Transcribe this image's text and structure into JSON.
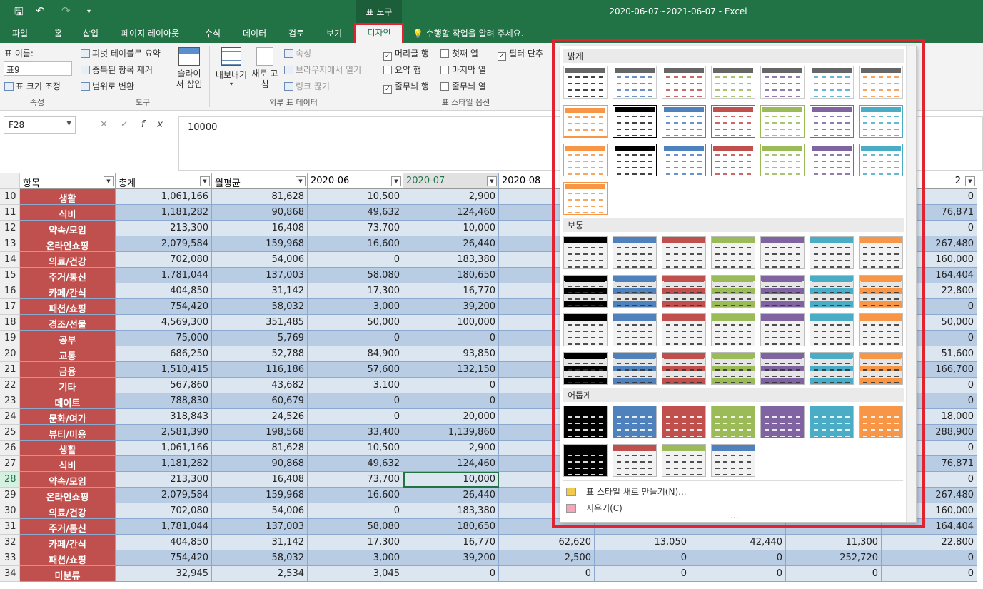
{
  "title_bar": {
    "doc_title": "2020-06-07~2021-06-07 - Excel",
    "context_label": "표 도구",
    "save": "🖫",
    "undo": "↶",
    "redo": "↷",
    "customize": "▾"
  },
  "tabs": [
    "파일",
    "홈",
    "삽입",
    "페이지 레이아웃",
    "수식",
    "데이터",
    "검토",
    "보기"
  ],
  "active_tab": "디자인",
  "tell_me": "수행할 작업을 알려 주세요.",
  "ribbon": {
    "props": {
      "table_name_label": "표 이름:",
      "table_name_value": "표9",
      "resize": "표 크기 조정",
      "group": "속성"
    },
    "tools": {
      "pivot": "피벗 테이블로 요약",
      "dedupe": "중복된 항목 제거",
      "convert": "범위로 변환",
      "slicer": "슬라이서 삽입",
      "group": "도구"
    },
    "external": {
      "export": "내보내기",
      "refresh": "새로 고침",
      "properties": "속성",
      "open_browser": "브라우저에서 열기",
      "unlink": "링크 끊기",
      "group": "외부 표 데이터"
    },
    "options": {
      "header_row": "머리글 행",
      "total_row": "요약 행",
      "banded_rows": "줄무늬 행",
      "first_col": "첫째 열",
      "last_col": "마지막 열",
      "banded_cols": "줄무늬 열",
      "filter": "필터 단추",
      "group": "표 스타일 옵션"
    }
  },
  "formula": {
    "cell_ref": "F28",
    "value": "10000"
  },
  "headers": [
    "항목",
    "총계",
    "월평균",
    "2020-06",
    "2020-07",
    "2020-08"
  ],
  "right_header_tail": "2",
  "rows": [
    {
      "n": "10",
      "cat": "생활",
      "total": "1,061,166",
      "avg": "81,628",
      "c1": "10,500",
      "c2": "2,900",
      "c3": "",
      "r": "0"
    },
    {
      "n": "11",
      "cat": "식비",
      "total": "1,181,282",
      "avg": "90,868",
      "c1": "49,632",
      "c2": "124,460",
      "c3": "",
      "r": "76,871"
    },
    {
      "n": "12",
      "cat": "약속/모임",
      "total": "213,300",
      "avg": "16,408",
      "c1": "73,700",
      "c2": "10,000",
      "c3": "",
      "r": "0"
    },
    {
      "n": "13",
      "cat": "온라인쇼핑",
      "total": "2,079,584",
      "avg": "159,968",
      "c1": "16,600",
      "c2": "26,440",
      "c3": "",
      "r": "267,480"
    },
    {
      "n": "14",
      "cat": "의료/건강",
      "total": "702,080",
      "avg": "54,006",
      "c1": "0",
      "c2": "183,380",
      "c3": "",
      "r": "160,000"
    },
    {
      "n": "15",
      "cat": "주거/통신",
      "total": "1,781,044",
      "avg": "137,003",
      "c1": "58,080",
      "c2": "180,650",
      "c3": "",
      "r": "164,404"
    },
    {
      "n": "16",
      "cat": "카페/간식",
      "total": "404,850",
      "avg": "31,142",
      "c1": "17,300",
      "c2": "16,770",
      "c3": "",
      "r": "22,800"
    },
    {
      "n": "17",
      "cat": "패션/쇼핑",
      "total": "754,420",
      "avg": "58,032",
      "c1": "3,000",
      "c2": "39,200",
      "c3": "",
      "r": "0"
    },
    {
      "n": "18",
      "cat": "경조/선물",
      "total": "4,569,300",
      "avg": "351,485",
      "c1": "50,000",
      "c2": "100,000",
      "c3": "",
      "r": "50,000"
    },
    {
      "n": "19",
      "cat": "공부",
      "total": "75,000",
      "avg": "5,769",
      "c1": "0",
      "c2": "0",
      "c3": "",
      "r": "0"
    },
    {
      "n": "20",
      "cat": "교통",
      "total": "686,250",
      "avg": "52,788",
      "c1": "84,900",
      "c2": "93,850",
      "c3": "",
      "r": "51,600"
    },
    {
      "n": "21",
      "cat": "금융",
      "total": "1,510,415",
      "avg": "116,186",
      "c1": "57,600",
      "c2": "132,150",
      "c3": "",
      "r": "166,700"
    },
    {
      "n": "22",
      "cat": "기타",
      "total": "567,860",
      "avg": "43,682",
      "c1": "3,100",
      "c2": "0",
      "c3": "",
      "r": "0"
    },
    {
      "n": "23",
      "cat": "데이트",
      "total": "788,830",
      "avg": "60,679",
      "c1": "0",
      "c2": "0",
      "c3": "",
      "r": "0"
    },
    {
      "n": "24",
      "cat": "문화/여가",
      "total": "318,843",
      "avg": "24,526",
      "c1": "0",
      "c2": "20,000",
      "c3": "",
      "r": "18,000"
    },
    {
      "n": "25",
      "cat": "뷰티/미용",
      "total": "2,581,390",
      "avg": "198,568",
      "c1": "33,400",
      "c2": "1,139,860",
      "c3": "",
      "r": "288,900"
    },
    {
      "n": "26",
      "cat": "생활",
      "total": "1,061,166",
      "avg": "81,628",
      "c1": "10,500",
      "c2": "2,900",
      "c3": "",
      "r": "0"
    },
    {
      "n": "27",
      "cat": "식비",
      "total": "1,181,282",
      "avg": "90,868",
      "c1": "49,632",
      "c2": "124,460",
      "c3": "",
      "r": "76,871"
    },
    {
      "n": "28",
      "cat": "약속/모임",
      "total": "213,300",
      "avg": "16,408",
      "c1": "73,700",
      "c2": "10,000",
      "c3": "",
      "r": "0"
    },
    {
      "n": "29",
      "cat": "온라인쇼핑",
      "total": "2,079,584",
      "avg": "159,968",
      "c1": "16,600",
      "c2": "26,440",
      "c3": "",
      "r": "267,480"
    },
    {
      "n": "30",
      "cat": "의료/건강",
      "total": "702,080",
      "avg": "54,006",
      "c1": "0",
      "c2": "183,380",
      "c3": "",
      "r": "160,000"
    },
    {
      "n": "31",
      "cat": "주거/통신",
      "total": "1,781,044",
      "avg": "137,003",
      "c1": "58,080",
      "c2": "180,650",
      "c3": "",
      "r": "164,404"
    },
    {
      "n": "32",
      "cat": "카페/간식",
      "total": "404,850",
      "avg": "31,142",
      "c1": "17,300",
      "c2": "16,770",
      "c3": "62,620",
      "d": [
        "13,050",
        "42,440",
        "11,300"
      ],
      "r": "22,800"
    },
    {
      "n": "33",
      "cat": "패션/쇼핑",
      "total": "754,420",
      "avg": "58,032",
      "c1": "3,000",
      "c2": "39,200",
      "c3": "2,500",
      "d": [
        "0",
        "0",
        "252,720"
      ],
      "r": "0"
    },
    {
      "n": "34",
      "cat": "미분류",
      "total": "32,945",
      "avg": "2,534",
      "c1": "3,045",
      "c2": "0",
      "c3": "0",
      "d": [
        "0",
        "0",
        "0"
      ],
      "r": "0"
    }
  ],
  "gallery": {
    "light": "밝게",
    "medium": "보통",
    "dark": "어둡게",
    "new_style": "표 스타일 새로 만들기(N)...",
    "clear": "지우기(C)",
    "resize_grip": "....",
    "colors": [
      "#000000",
      "#4f81bd",
      "#c0504d",
      "#9bbb59",
      "#8064a2",
      "#4bacc6",
      "#f79646"
    ]
  }
}
